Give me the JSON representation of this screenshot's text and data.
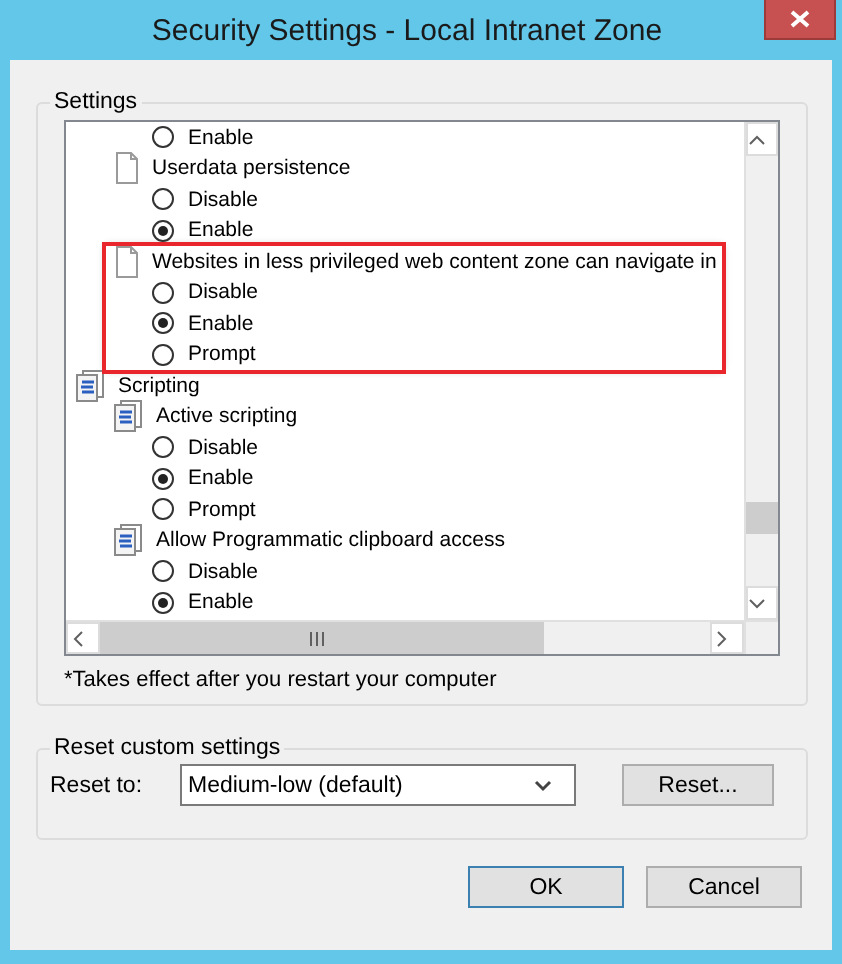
{
  "window": {
    "title": "Security Settings - Local Intranet Zone"
  },
  "settings": {
    "label": "Settings",
    "tree": [
      {
        "kind": "hidden",
        "children": [
          {
            "kind": "hidden",
            "children": [
              {
                "kind": "radio",
                "label": "Enable",
                "selected": false
              }
            ]
          },
          {
            "kind": "setting",
            "label": "Userdata persistence",
            "highlighted": false,
            "children": [
              {
                "kind": "radio",
                "label": "Disable",
                "selected": false
              },
              {
                "kind": "radio",
                "label": "Enable",
                "selected": true
              }
            ]
          },
          {
            "kind": "setting",
            "label": "Websites in less privileged web content zone can navigate in",
            "highlighted": true,
            "children": [
              {
                "kind": "radio",
                "label": "Disable",
                "selected": false
              },
              {
                "kind": "radio",
                "label": "Enable",
                "selected": true
              },
              {
                "kind": "radio",
                "label": "Prompt",
                "selected": false
              }
            ]
          }
        ]
      },
      {
        "kind": "category",
        "label": "Scripting",
        "children": [
          {
            "kind": "category",
            "label": "Active scripting",
            "children": [
              {
                "kind": "radio",
                "label": "Disable",
                "selected": false
              },
              {
                "kind": "radio",
                "label": "Enable",
                "selected": true
              },
              {
                "kind": "radio",
                "label": "Prompt",
                "selected": false
              }
            ]
          },
          {
            "kind": "category",
            "label": "Allow Programmatic clipboard access",
            "children": [
              {
                "kind": "radio",
                "label": "Disable",
                "selected": false
              },
              {
                "kind": "radio",
                "label": "Enable",
                "selected": true
              }
            ]
          }
        ]
      }
    ],
    "note": "*Takes effect after you restart your computer"
  },
  "reset": {
    "label": "Reset custom settings",
    "field_label": "Reset to:",
    "value": "Medium-low (default)",
    "button": "Reset..."
  },
  "buttons": [
    "OK",
    "Cancel"
  ]
}
